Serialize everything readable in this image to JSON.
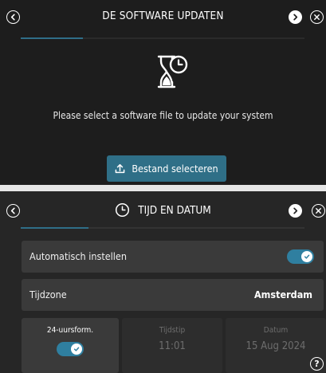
{
  "software_panel": {
    "title": "DE SOFTWARE UPDATEN",
    "progress_fraction": 0.22,
    "message": "Please select a software file to update your system",
    "select_button_label": "Bestand selecteren",
    "back_icon": "chevron-left-circle-icon",
    "next_icon": "chevron-right-circle-icon",
    "close_icon": "close-circle-icon",
    "illustration_icon": "hourglass-clock-icon",
    "upload_icon": "upload-icon"
  },
  "time_panel": {
    "title": "TIJD EN DATUM",
    "title_icon": "clock-icon",
    "progress_fraction": 0.24,
    "auto_set": {
      "label": "Automatisch instellen",
      "enabled": true
    },
    "timezone": {
      "label": "Tijdzone",
      "value": "Amsterdam"
    },
    "format_24h": {
      "label": "24-uursform.",
      "enabled": true
    },
    "time": {
      "label": "Tijdstip",
      "value": "11:01"
    },
    "date": {
      "label": "Datum",
      "value": "15 Aug 2024"
    },
    "help_label": "?"
  },
  "colors": {
    "accent": "#2f6f87",
    "toggle_on": "#2f7fa0",
    "panel_bg": "#1d1d1d",
    "row_bg": "#3a3a3a"
  }
}
